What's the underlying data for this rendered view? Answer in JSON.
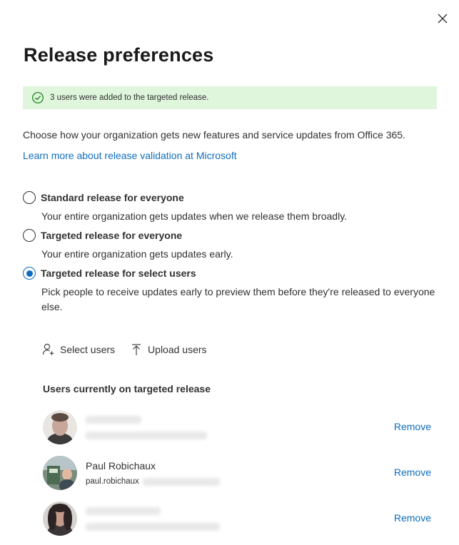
{
  "dialog": {
    "close_icon": "close-icon",
    "title": "Release preferences"
  },
  "banner": {
    "icon": "check-circle-icon",
    "text": "3 users were added to the targeted release.",
    "background": "#dff6dd",
    "icon_color": "#107c10"
  },
  "description": "Choose how your organization gets new features and service updates from Office 365.",
  "learn_more_link": "Learn more about release validation at Microsoft",
  "release_options": [
    {
      "label": "Standard release for everyone",
      "description": "Your entire organization gets updates when we release them broadly.",
      "selected": false
    },
    {
      "label": "Targeted release for everyone",
      "description": "Your entire organization gets updates early.",
      "selected": false
    },
    {
      "label": "Targeted release for select users",
      "description": "Pick people to receive updates early to preview them before they're released to everyone else.",
      "selected": true
    }
  ],
  "actions": {
    "select_users": {
      "label": "Select users",
      "icon": "add-person-icon"
    },
    "upload_users": {
      "label": "Upload users",
      "icon": "upload-icon"
    }
  },
  "users_section_title": "Users currently on targeted release",
  "users": [
    {
      "name": "",
      "email": "",
      "name_redacted": true,
      "email_redacted": true,
      "remove_label": "Remove"
    },
    {
      "name": "Paul Robichaux",
      "email": "paul.robichaux",
      "name_redacted": false,
      "email_redacted": true,
      "remove_label": "Remove"
    },
    {
      "name": "",
      "email": "",
      "name_redacted": true,
      "email_redacted": true,
      "remove_label": "Remove"
    }
  ],
  "colors": {
    "accent": "#0f6cbd",
    "text": "#323130",
    "title": "#1b1a19"
  }
}
